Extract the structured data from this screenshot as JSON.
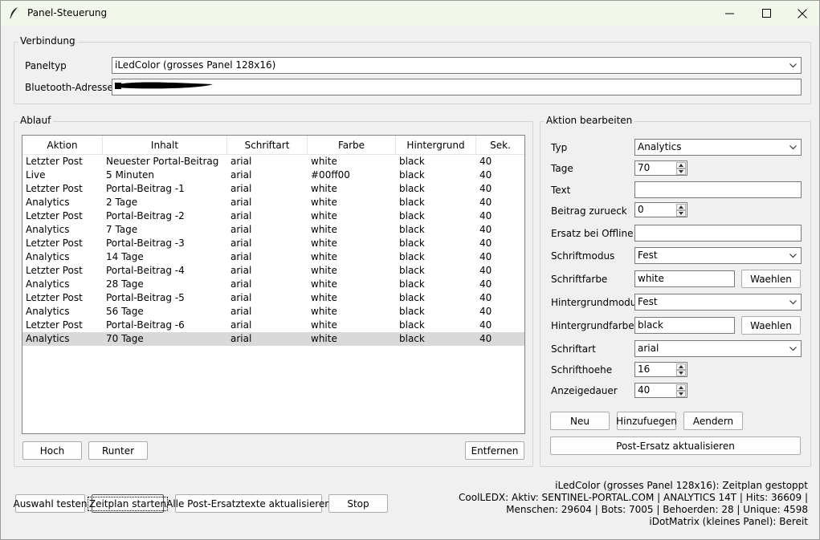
{
  "window": {
    "title": "Panel-Steuerung"
  },
  "verbindung": {
    "label": "Verbindung",
    "paneltyp_label": "Paneltyp",
    "paneltyp_value": "iLedColor (grosses Panel 128x16)",
    "bluetooth_label": "Bluetooth-Adresse"
  },
  "ablauf": {
    "label": "Ablauf",
    "columns": [
      "Aktion",
      "Inhalt",
      "Schriftart",
      "Farbe",
      "Hintergrund",
      "Sek."
    ],
    "rows": [
      [
        "Letzter Post",
        "Neuester Portal-Beitrag",
        "arial",
        "white",
        "black",
        "40"
      ],
      [
        "Live",
        "5 Minuten",
        "arial",
        "#00ff00",
        "black",
        "40"
      ],
      [
        "Letzter Post",
        "Portal-Beitrag -1",
        "arial",
        "white",
        "black",
        "40"
      ],
      [
        "Analytics",
        "2 Tage",
        "arial",
        "white",
        "black",
        "40"
      ],
      [
        "Letzter Post",
        "Portal-Beitrag -2",
        "arial",
        "white",
        "black",
        "40"
      ],
      [
        "Analytics",
        "7 Tage",
        "arial",
        "white",
        "black",
        "40"
      ],
      [
        "Letzter Post",
        "Portal-Beitrag -3",
        "arial",
        "white",
        "black",
        "40"
      ],
      [
        "Analytics",
        "14 Tage",
        "arial",
        "white",
        "black",
        "40"
      ],
      [
        "Letzter Post",
        "Portal-Beitrag -4",
        "arial",
        "white",
        "black",
        "40"
      ],
      [
        "Analytics",
        "28 Tage",
        "arial",
        "white",
        "black",
        "40"
      ],
      [
        "Letzter Post",
        "Portal-Beitrag -5",
        "arial",
        "white",
        "black",
        "40"
      ],
      [
        "Analytics",
        "56 Tage",
        "arial",
        "white",
        "black",
        "40"
      ],
      [
        "Letzter Post",
        "Portal-Beitrag -6",
        "arial",
        "white",
        "black",
        "40"
      ],
      [
        "Analytics",
        "70 Tage",
        "arial",
        "white",
        "black",
        "40"
      ]
    ],
    "selected_row": 13,
    "buttons": {
      "hoch": "Hoch",
      "runter": "Runter",
      "entfernen": "Entfernen"
    }
  },
  "aktion": {
    "label": "Aktion bearbeiten",
    "typ_label": "Typ",
    "typ_value": "Analytics",
    "tage_label": "Tage",
    "tage_value": "70",
    "text_label": "Text",
    "text_value": "",
    "beitrag_label": "Beitrag zurueck",
    "beitrag_value": "0",
    "ersatz_label": "Ersatz bei Offline",
    "ersatz_value": "",
    "schriftmodus_label": "Schriftmodus",
    "schriftmodus_value": "Fest",
    "schriftfarbe_label": "Schriftfarbe",
    "schriftfarbe_value": "white",
    "hintergrundmodus_label": "Hintergrundmodus",
    "hintergrundmodus_value": "Fest",
    "hintergrundfarbe_label": "Hintergrundfarbe",
    "hintergrundfarbe_value": "black",
    "schriftart_label": "Schriftart",
    "schriftart_value": "arial",
    "schrifthoehe_label": "Schrifthoehe",
    "schrifthoehe_value": "16",
    "anzeigedauer_label": "Anzeigedauer",
    "anzeigedauer_value": "40",
    "waehlen": "Waehlen",
    "neu": "Neu",
    "hinzufuegen": "Hinzufuegen",
    "aendern": "Aendern",
    "post_ersatz": "Post-Ersatz aktualisieren"
  },
  "bottom": {
    "auswahl_testen": "Auswahl testen",
    "zeitplan_starten": "Zeitplan starten",
    "alle_post": "Alle Post-Ersatztexte aktualisieren",
    "stop": "Stop"
  },
  "status": {
    "line1": "iLedColor (grosses Panel 128x16): Zeitplan gestoppt",
    "line2": "CoolLEDX: Aktiv: SENTINEL-PORTAL.COM | ANALYTICS 14T | Hits: 36609 |",
    "line3": "Menschen: 29604 | Bots: 7005 | Behoerden: 28 | Unique: 4598",
    "line4": "iDotMatrix (kleines Panel): Bereit"
  }
}
